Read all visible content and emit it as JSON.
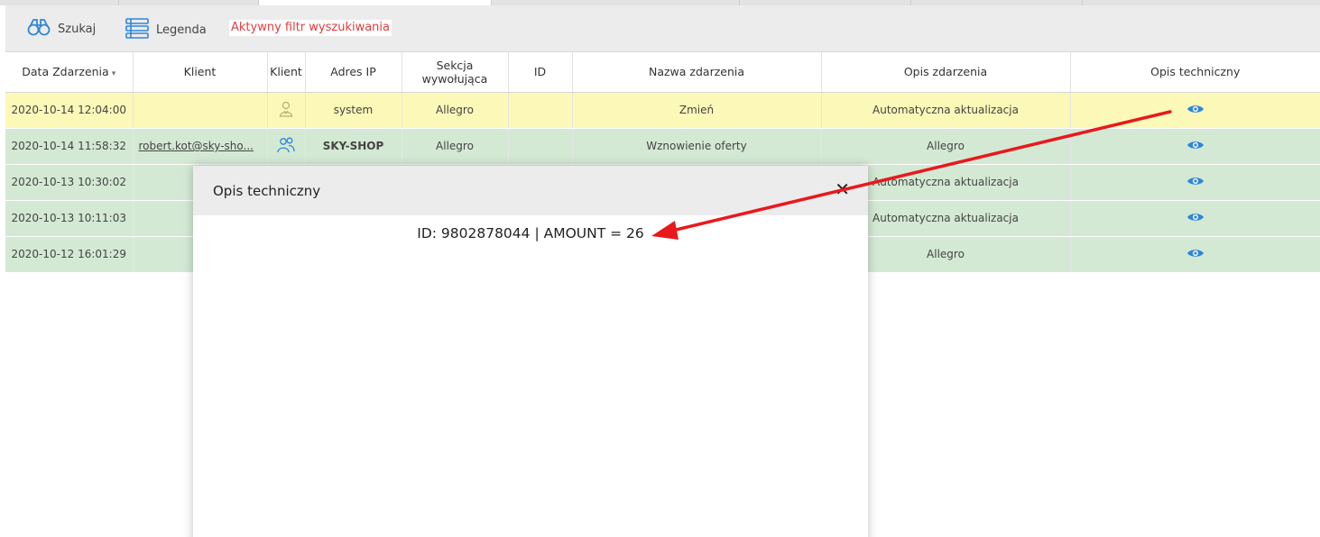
{
  "toolbar": {
    "search_label": "Szukaj",
    "legend_label": "Legenda",
    "filter_label": "Aktywny filtr wyszukiwania"
  },
  "table": {
    "headers": [
      "Data Zdarzenia",
      "Klient",
      "Klient",
      "Adres IP",
      "Sekcja wywołująca",
      "ID",
      "Nazwa zdarzenia",
      "Opis zdarzenia",
      "Opis techniczny"
    ],
    "sort_caret": "▾",
    "rows": [
      {
        "date": "2020-10-14 12:04:00",
        "client": "",
        "client_icon": "person-icon",
        "ip": "system",
        "section": "Allegro",
        "id": "",
        "name": "Zmień",
        "desc": "Automatyczna aktualizacja",
        "color": "yellow"
      },
      {
        "date": "2020-10-14 11:58:32",
        "client": "robert.kot@sky-sho...",
        "client_icon": "group-icon",
        "ip": "SKY-SHOP",
        "section": "Allegro",
        "id": "",
        "name": "Wznowienie oferty",
        "desc": "Allegro",
        "color": "green"
      },
      {
        "date": "2020-10-13 10:30:02",
        "client": "",
        "client_icon": "",
        "ip": "",
        "section": "",
        "id": "",
        "name": "",
        "desc": "Automatyczna aktualizacja",
        "color": "green"
      },
      {
        "date": "2020-10-13 10:11:03",
        "client": "",
        "client_icon": "",
        "ip": "",
        "section": "",
        "id": "",
        "name": "",
        "desc": "Automatyczna aktualizacja",
        "color": "green"
      },
      {
        "date": "2020-10-12 16:01:29",
        "client": "",
        "client_icon": "",
        "ip": "",
        "section": "",
        "id": "",
        "name": "",
        "desc": "Allegro",
        "color": "green"
      }
    ]
  },
  "modal": {
    "title": "Opis techniczny",
    "close": "✕",
    "content": "ID: 9802878044 | AMOUNT = 26"
  },
  "colors": {
    "row_yellow": "#fbf8b8",
    "row_green": "#d3e9d4",
    "icon_blue": "#2f86d6",
    "filter_red": "#e23b3b",
    "arrow_red": "#e8191d"
  }
}
